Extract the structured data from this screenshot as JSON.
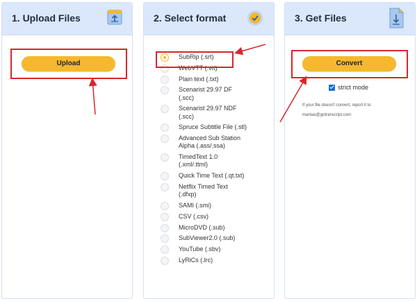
{
  "panels": {
    "upload": {
      "title": "1. Upload Files",
      "button_label": "Upload",
      "icon": "upload-icon"
    },
    "format": {
      "title": "2. Select format",
      "icon": "check-circle-icon",
      "selected_index": 0,
      "options": [
        {
          "lines": [
            "SubRip (.srt)"
          ]
        },
        {
          "lines": [
            "WebVTT (.vtt)"
          ]
        },
        {
          "lines": [
            "Plain text (.txt)"
          ]
        },
        {
          "lines": [
            "Scenarist 29.97 DF",
            "(.scc)"
          ]
        },
        {
          "lines": [
            "Scenarist 29.97 NDF",
            "(.scc)"
          ]
        },
        {
          "lines": [
            "Spruce Subtitle File (.stl)"
          ]
        },
        {
          "lines": [
            "Advanced Sub Station",
            "Alpha (.ass/.ssa)"
          ]
        },
        {
          "lines": [
            "TimedText 1.0",
            "(.xml/.ttml)"
          ]
        },
        {
          "lines": [
            "Quick Time Text (.qt.txt)"
          ]
        },
        {
          "lines": [
            "Netflix Timed Text",
            "(.dfxp)"
          ]
        },
        {
          "lines": [
            "SAMI (.smi)"
          ]
        },
        {
          "lines": [
            "CSV (.csv)"
          ]
        },
        {
          "lines": [
            "MicroDVD (.sub)"
          ]
        },
        {
          "lines": [
            "SubViewer2.0 (.sub)"
          ]
        },
        {
          "lines": [
            "YouTube (.sbv)"
          ]
        },
        {
          "lines": [
            "LyRiCs (.lrc)"
          ]
        }
      ]
    },
    "files": {
      "title": "3. Get Files",
      "icon": "download-icon",
      "button_label": "Convert",
      "strict_mode_label": "strict mode",
      "strict_mode_checked": true,
      "note_line1": "If your file doesn't convert, report it to",
      "note_line2": "mantas@gotranscript.com"
    }
  },
  "colors": {
    "accent": "#f5b82e",
    "header_bg": "#dbe7fb",
    "highlight_red": "#d7262c",
    "checkbox_blue": "#1a6fd1"
  }
}
